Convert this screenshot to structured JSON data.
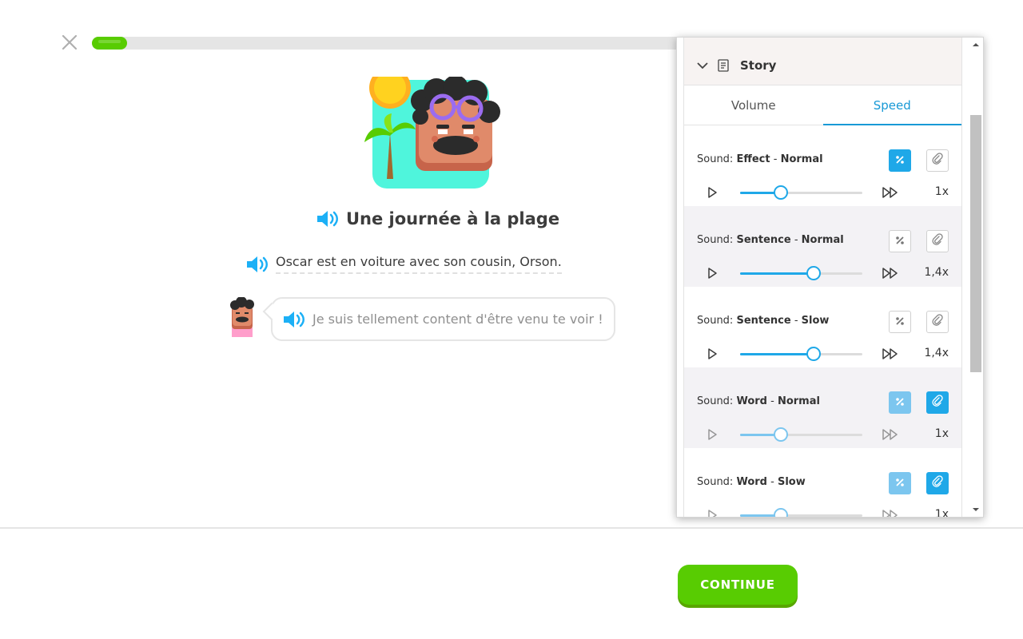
{
  "header": {
    "close_icon": "close-icon",
    "progress_fraction": 0.06
  },
  "story": {
    "title": "Une journée à la plage",
    "line1": "Oscar est en voiture avec son cousin, Orson.",
    "bubble": "Je suis tellement content d'être venu te voir !"
  },
  "footer": {
    "continue_label": "CONTINUE"
  },
  "panel": {
    "section_label": "Story",
    "tabs": [
      {
        "label": "Volume",
        "active": false
      },
      {
        "label": "Speed",
        "active": true
      }
    ],
    "sounds": [
      {
        "prefix": "Sound: ",
        "kind": "Effect",
        "sep": " - ",
        "variant": "Normal",
        "value": "1x",
        "speed": 1.0,
        "percent_state": "on",
        "clip_state": "off"
      },
      {
        "prefix": "Sound: ",
        "kind": "Sentence",
        "sep": " - ",
        "variant": "Normal",
        "value": "1,4x",
        "speed": 1.4,
        "percent_state": "off",
        "clip_state": "off"
      },
      {
        "prefix": "Sound: ",
        "kind": "Sentence",
        "sep": " - ",
        "variant": "Slow",
        "value": "1,4x",
        "speed": 1.4,
        "percent_state": "off",
        "clip_state": "off"
      },
      {
        "prefix": "Sound: ",
        "kind": "Word",
        "sep": " - ",
        "variant": "Normal",
        "value": "1x",
        "speed": 1.0,
        "percent_state": "on-faded",
        "clip_state": "on"
      },
      {
        "prefix": "Sound: ",
        "kind": "Word",
        "sep": " - ",
        "variant": "Slow",
        "value": "1x",
        "speed": 1.0,
        "percent_state": "on-faded",
        "clip_state": "on"
      }
    ]
  },
  "colors": {
    "brand_green": "#58cc02",
    "accent_blue": "#1fa8e8",
    "tab_active": "#1899d6"
  }
}
